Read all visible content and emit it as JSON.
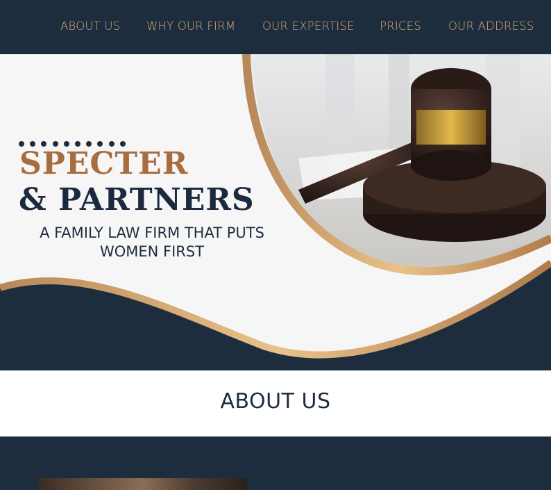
{
  "nav": {
    "items": [
      {
        "label": "ABOUT US"
      },
      {
        "label": "WHY OUR FIRM"
      },
      {
        "label": "OUR EXPERTISE"
      },
      {
        "label": "PRICES"
      },
      {
        "label": "OUR ADDRESS"
      }
    ]
  },
  "hero": {
    "brand_line1": "SPECTER",
    "brand_line2": "& PARTNERS",
    "tagline": "A FAMILY LAW FIRM THAT PUTS WOMEN FIRST",
    "dot_count": 10,
    "image": "gavel-image"
  },
  "about": {
    "title": "ABOUT US"
  },
  "colors": {
    "navy": "#1e2d3e",
    "gold": "#d4a878",
    "bronze": "#a86d3f"
  }
}
